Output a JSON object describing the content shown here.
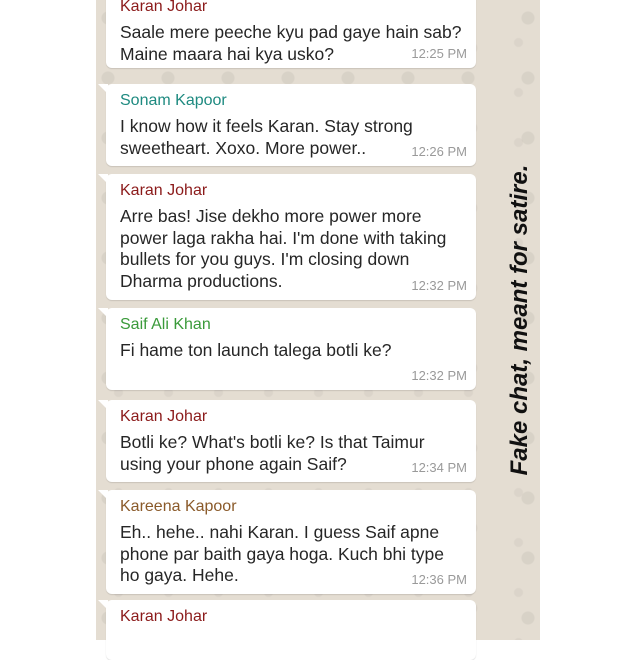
{
  "messages": [
    {
      "sender": "Karan Johar",
      "sender_color": "#8b1a1a",
      "text": "Saale mere peeche kyu pad gaye hain sab? Maine maara hai kya usko?",
      "time": "12:25 PM"
    },
    {
      "sender": "Sonam Kapoor",
      "sender_color": "#1e8a80",
      "text": "I know how it feels Karan. Stay strong sweetheart. Xoxo. More power..",
      "time": "12:26 PM"
    },
    {
      "sender": "Karan Johar",
      "sender_color": "#8b1a1a",
      "text": "Arre bas! Jise dekho more power more power laga rakha hai. I'm done with taking bullets for you guys. I'm closing down Dharma productions.",
      "time": "12:32 PM"
    },
    {
      "sender": "Saif Ali Khan",
      "sender_color": "#3a9a3a",
      "text": "Fi hame ton launch talega botli ke?",
      "time": "12:32 PM"
    },
    {
      "sender": "Karan Johar",
      "sender_color": "#8b1a1a",
      "text": "Botli ke? What's botli ke? Is that Taimur using your phone again Saif?",
      "time": "12:34 PM"
    },
    {
      "sender": "Kareena Kapoor",
      "sender_color": "#8a5a2a",
      "text": "Eh.. hehe.. nahi Karan. I guess Saif apne phone par baith gaya hoga. Kuch bhi type ho gaya. Hehe.",
      "time": "12:36 PM"
    },
    {
      "sender": "Karan Johar",
      "sender_color": "#8b1a1a",
      "text": "",
      "time": ""
    }
  ],
  "side_note": "Fake chat, meant for satire.",
  "colors": {
    "chat_background": "#e4ddd2",
    "bubble": "#ffffff",
    "timestamp": "#9a9a9a"
  }
}
